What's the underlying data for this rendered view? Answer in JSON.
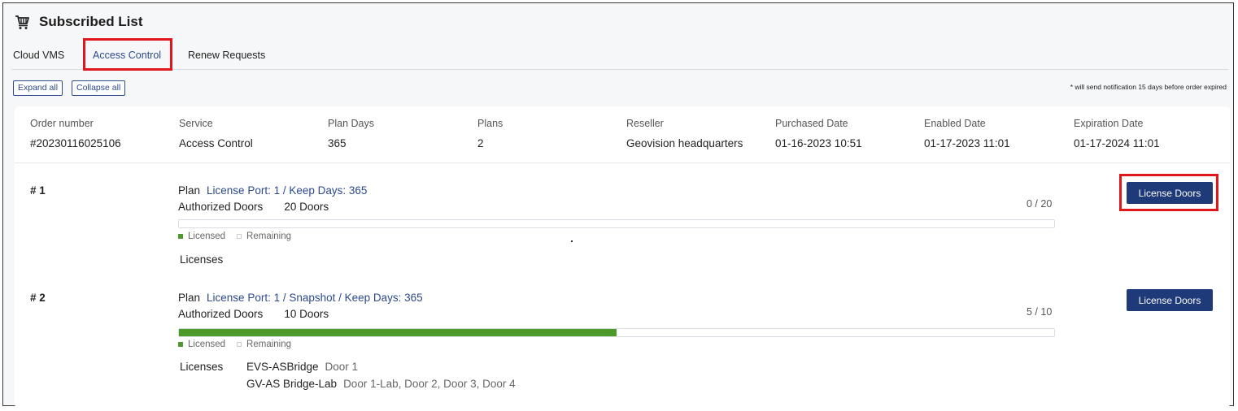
{
  "header": {
    "title": "Subscribed List",
    "icon": "cart-icon"
  },
  "tabs": [
    {
      "label": "Cloud VMS",
      "active": false
    },
    {
      "label": "Access Control",
      "active": true
    },
    {
      "label": "Renew Requests",
      "active": false
    }
  ],
  "toolbar": {
    "expand_label": "Expand all",
    "collapse_label": "Collapse all",
    "note": "* will send notification 15 days before order expired"
  },
  "order": {
    "columns": [
      {
        "label": "Order number",
        "value": "#20230116025106"
      },
      {
        "label": "Service",
        "value": "Access Control"
      },
      {
        "label": "Plan Days",
        "value": "365"
      },
      {
        "label": "Plans",
        "value": "2"
      },
      {
        "label": "Reseller",
        "value": "Geovision headquarters"
      },
      {
        "label": "Purchased Date",
        "value": "01-16-2023 10:51"
      },
      {
        "label": "Enabled Date",
        "value": "01-17-2023 11:01"
      },
      {
        "label": "Expiration Date",
        "value": "01-17-2024 11:01"
      }
    ]
  },
  "labels": {
    "plan": "Plan",
    "authorized_doors": "Authorized Doors",
    "licensed": "Licensed",
    "remaining": "Remaining",
    "licenses": "Licenses",
    "license_doors_button": "License Doors"
  },
  "plans": [
    {
      "number": "# 1",
      "detail": "License Port: 1 / Keep Days: 365",
      "doors": "20 Doors",
      "count": "0 / 20",
      "licensed_fraction": 0.0,
      "licenses": []
    },
    {
      "number": "# 2",
      "detail": "License Port: 1 / Snapshot / Keep Days: 365",
      "doors": "10 Doors",
      "count": "5 / 10",
      "licensed_fraction": 0.5,
      "licenses": [
        {
          "device": "EVS-ASBridge",
          "doors": "Door 1"
        },
        {
          "device": "GV-AS Bridge-Lab",
          "doors": "Door 1-Lab, Door 2, Door 3, Door 4"
        }
      ]
    }
  ],
  "colors": {
    "accent": "#1f3a78",
    "link": "#2c4a8c",
    "licensed": "#4d9a2c",
    "highlight": "#e0161d"
  }
}
